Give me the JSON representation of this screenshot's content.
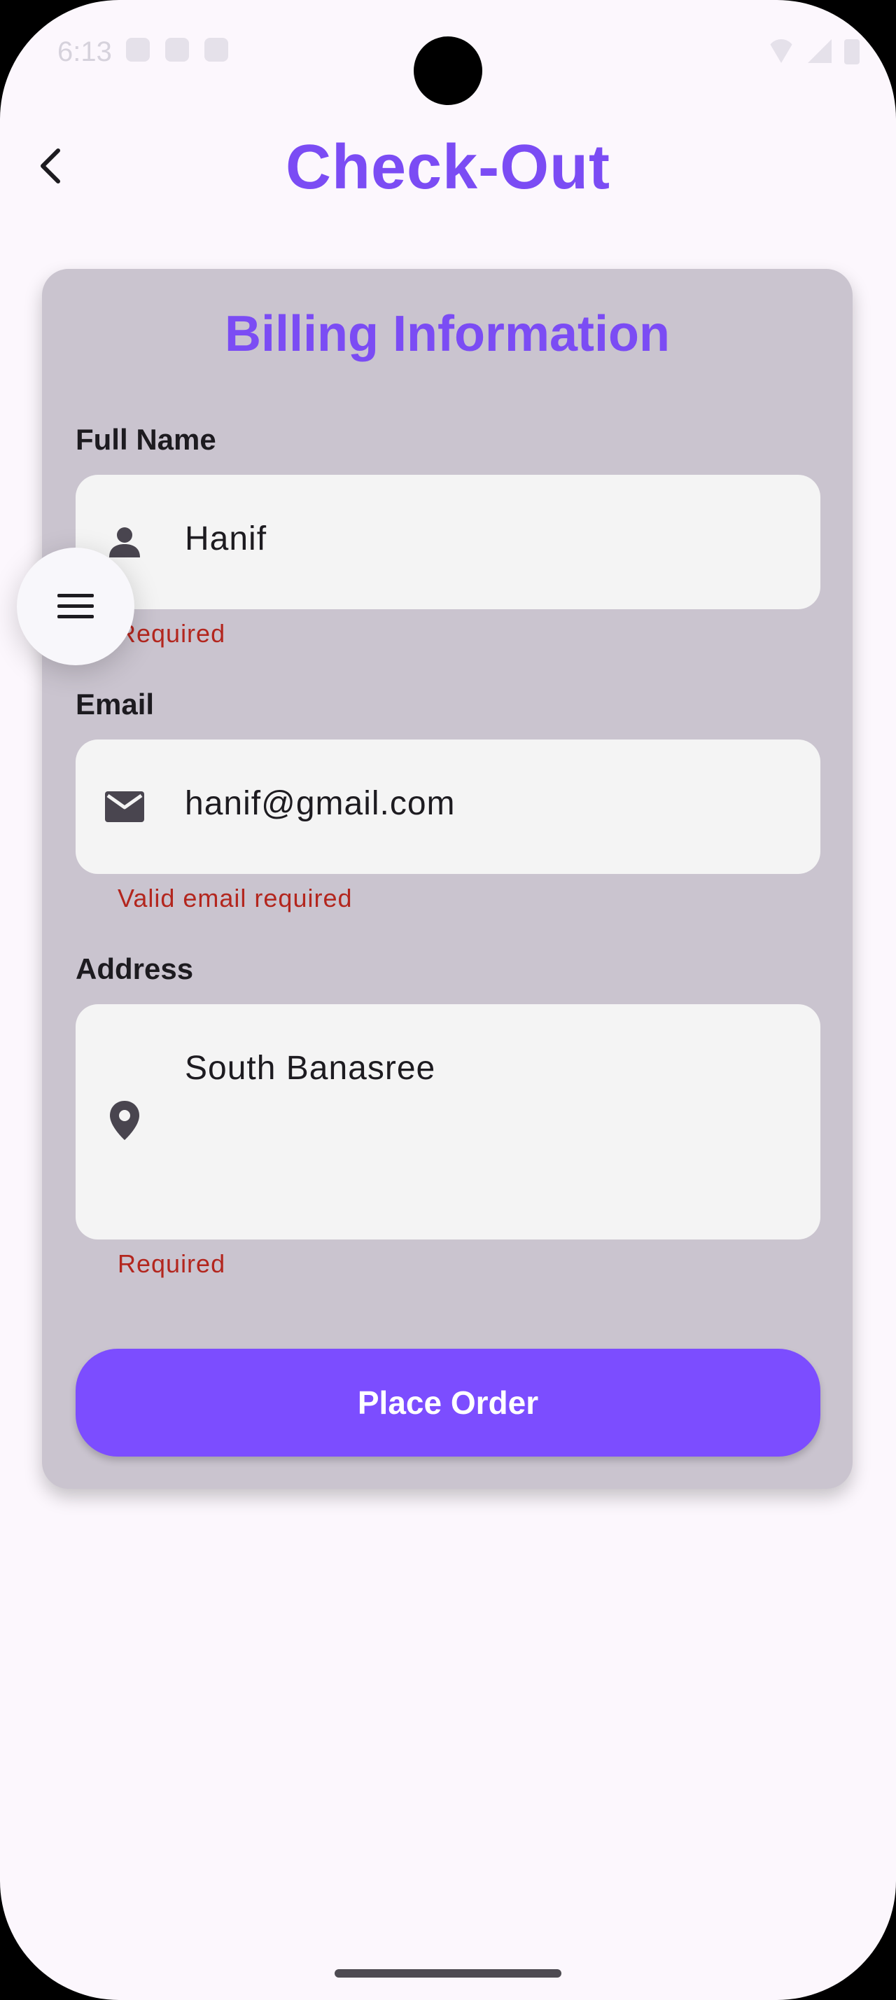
{
  "status_bar": {
    "time": "6:13"
  },
  "app_bar": {
    "title": "Check-Out",
    "back_icon": "arrow-back-icon"
  },
  "billing_card": {
    "title": "Billing Information",
    "full_name": {
      "label": "Full Name",
      "value": "Hanif",
      "icon": "person-icon",
      "error": "Required"
    },
    "email": {
      "label": "Email",
      "value": "hanif@gmail.com",
      "icon": "mail-icon",
      "error": "Valid email required"
    },
    "address": {
      "label": "Address",
      "value": "South Banasree",
      "icon": "location-pin-icon",
      "error": "Required"
    },
    "submit_label": "Place Order"
  },
  "floating_menu": {
    "icon": "menu-icon"
  },
  "colors": {
    "accent": "#7C4DFF",
    "title": "#7B4CF4",
    "card_bg": "#CAC4CF",
    "error": "#B3261E",
    "page_bg": "#FCF7FD"
  }
}
